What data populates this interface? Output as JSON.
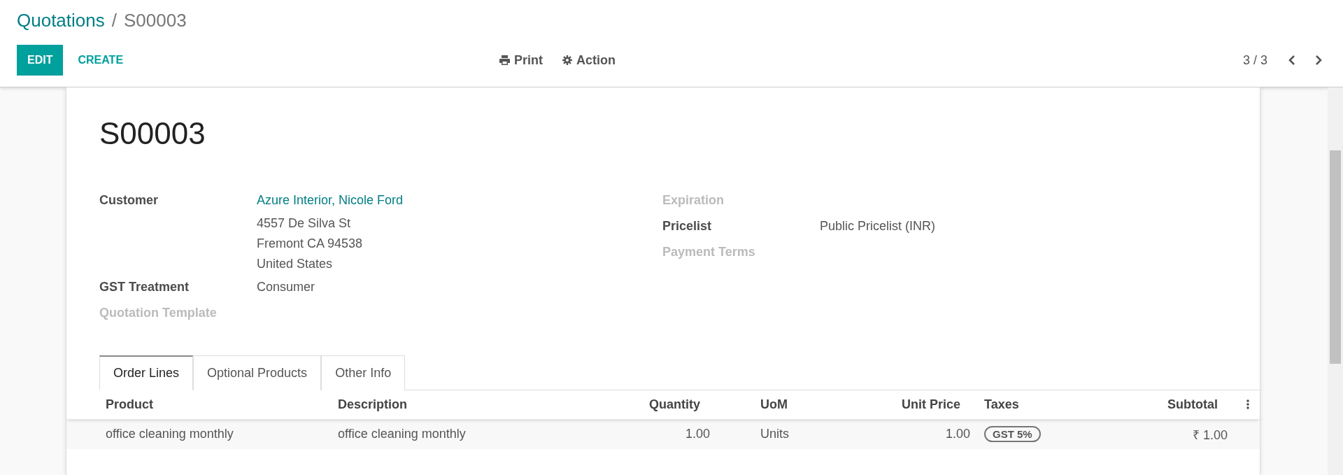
{
  "breadcrumb": {
    "items": [
      {
        "label": "Quotations",
        "kind": "link"
      },
      {
        "label": "S00003",
        "kind": "current"
      }
    ],
    "separator": "/"
  },
  "buttons": [
    {
      "label": "EDIT",
      "kind": "primary"
    },
    {
      "label": "CREATE",
      "kind": "link"
    }
  ],
  "actions": [
    {
      "label": "Print",
      "kind": "print"
    },
    {
      "label": "Action",
      "kind": "gear"
    }
  ],
  "pager": {
    "text": "3 / 3"
  },
  "form": {
    "title": "S00003",
    "left_fields": [
      {
        "label": "Customer",
        "kind": "link",
        "value": "Azure Interior, Nicole Ford",
        "lines": [
          "4557 De Silva St",
          "Fremont CA 94538",
          "United States"
        ]
      },
      {
        "label": "GST Treatment",
        "kind": "text",
        "value": "Consumer"
      },
      {
        "label": "Quotation Template",
        "kind": "empty"
      }
    ],
    "right_fields": [
      {
        "label": "Expiration",
        "kind": "empty"
      },
      {
        "label": "Pricelist",
        "kind": "text",
        "value": "Public Pricelist (INR)"
      },
      {
        "label": "Payment Terms",
        "kind": "empty"
      }
    ]
  },
  "tabs": [
    {
      "label": "Order Lines",
      "selected": true
    },
    {
      "label": "Optional Products",
      "selected": false
    },
    {
      "label": "Other Info",
      "selected": false
    }
  ],
  "table": {
    "columns": [
      {
        "label": "Product",
        "kind": "text"
      },
      {
        "label": "Description",
        "kind": "text"
      },
      {
        "label": "Quantity",
        "kind": "number"
      },
      {
        "label": "UoM",
        "kind": "uom"
      },
      {
        "label": "Unit Price",
        "kind": "number"
      },
      {
        "label": "Taxes",
        "kind": "tags"
      },
      {
        "label": "Subtotal",
        "kind": "number"
      }
    ],
    "rows": [
      {
        "cells": [
          {
            "text": "office cleaning monthly"
          },
          {
            "text": "office cleaning monthly"
          },
          {
            "text": "1.00"
          },
          {
            "text": "Units"
          },
          {
            "text": "1.00"
          },
          {
            "tags": [
              "GST 5%"
            ]
          },
          {
            "text": "₹ 1.00"
          }
        ]
      }
    ]
  }
}
